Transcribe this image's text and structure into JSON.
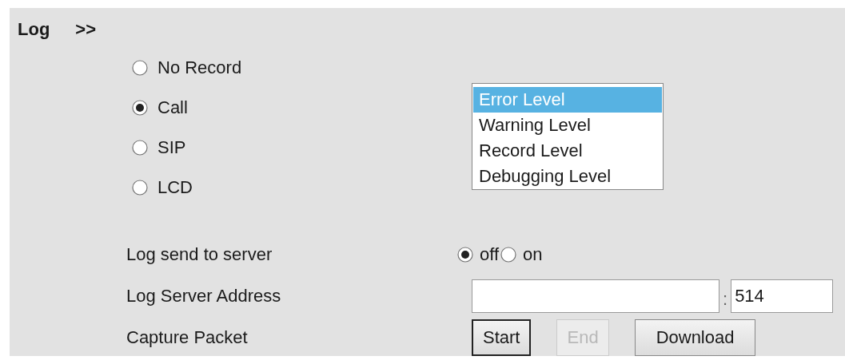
{
  "header": {
    "title": "Log",
    "nav": ">>"
  },
  "log_types": [
    {
      "label": "No Record",
      "selected": false
    },
    {
      "label": "Call",
      "selected": true
    },
    {
      "label": "SIP",
      "selected": false
    },
    {
      "label": "LCD",
      "selected": false
    }
  ],
  "log_levels": [
    {
      "label": "Error Level",
      "selected": true
    },
    {
      "label": "Warning Level",
      "selected": false
    },
    {
      "label": "Record Level",
      "selected": false
    },
    {
      "label": "Debugging Level",
      "selected": false
    }
  ],
  "send_to_server": {
    "label": "Log send to server",
    "options": [
      {
        "label": "off",
        "selected": true
      },
      {
        "label": "on",
        "selected": false
      }
    ]
  },
  "server_address": {
    "label": "Log Server Address",
    "separator": ":",
    "port": "514"
  },
  "capture_packet": {
    "label": "Capture Packet",
    "buttons": [
      {
        "label": "Start",
        "focused": true,
        "disabled": false
      },
      {
        "label": "End",
        "focused": false,
        "disabled": true
      },
      {
        "label": "Download",
        "focused": false,
        "disabled": false
      }
    ]
  }
}
